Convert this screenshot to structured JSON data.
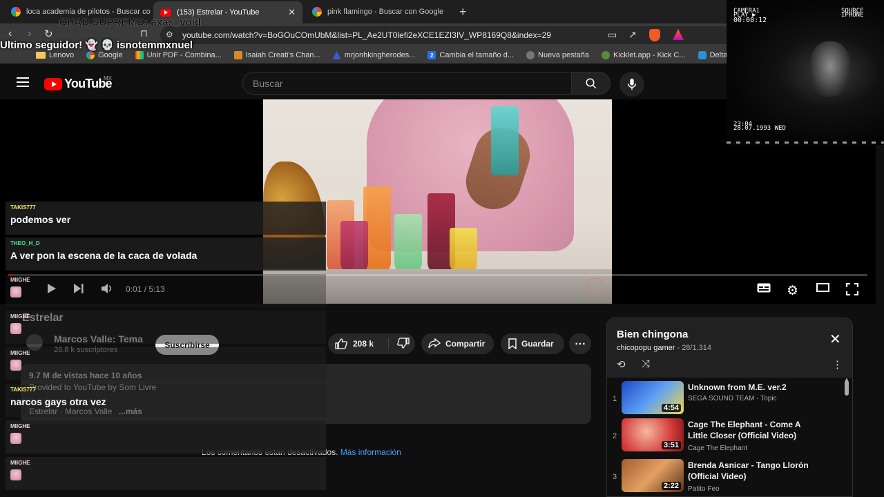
{
  "browser": {
    "tabs": [
      {
        "title": "loca academia de pilotos - Buscar con",
        "icon": "google-icon",
        "active": false
      },
      {
        "title": "(153) Estrelar - YouTube",
        "icon": "youtube-icon",
        "active": true
      },
      {
        "title": "pink flamingo - Buscar con Google",
        "icon": "google-icon",
        "active": false
      }
    ],
    "url": "youtube.com/watch?v=BoGOuCOmUbM&list=PL_Ae2UT0lefi2eXCE1EZI3IV_WP8169Q8&index=29",
    "bookmarks": [
      {
        "label": "Lenovo",
        "icon": "folder-icon"
      },
      {
        "label": "Google",
        "icon": "google-icon"
      },
      {
        "label": "Unir PDF - Combina...",
        "icon": "pdf-icon"
      },
      {
        "label": "Isaiah Creati's Chan...",
        "icon": "image-icon"
      },
      {
        "label": "mrjonhkingherodes...",
        "icon": "drive-icon"
      },
      {
        "label": "Cambia el tamaño d...",
        "icon": "resize-icon"
      },
      {
        "label": "Nueva pestaña",
        "icon": "globe-icon"
      },
      {
        "label": "Kicklet.app - Kick C...",
        "icon": "kicklet-icon"
      },
      {
        "label": "Deltarune: C",
        "icon": "deltarune-icon"
      }
    ]
  },
  "youtube": {
    "logo": "YouTube",
    "region": "MX",
    "search_placeholder": "Buscar"
  },
  "player": {
    "time": "0:01 / 5:13",
    "progress": 0.003
  },
  "video": {
    "title": "Estrelar",
    "channel": "Marcos Valle: Tema",
    "subscribers": "26.8 k suscriptores",
    "subscribe_label": "Suscribirse",
    "likes": "208 k",
    "share_label": "Compartir",
    "save_label": "Guardar",
    "views_age": "9.7 M de vistas  hace 10 años",
    "description_line1": "Provided to YouTube by Som Livre",
    "description_line2": "Estrelar · Marcos Valle",
    "more_label": "...más",
    "comments_off": "Los comentarios están desactivados.",
    "more_info": "Más información"
  },
  "playlist": {
    "title": "Bien chingona",
    "owner": "chicopopu gamer",
    "position": "28/1,314",
    "items": [
      {
        "index": "1",
        "title": "Unknown from M.E. ver.2",
        "channel": "SEGA SOUND TEAM - Topic",
        "duration": "4:54"
      },
      {
        "index": "2",
        "title": "Cage The Elephant - Come A Little Closer (Official Video)",
        "channel": "Cage The Elephant",
        "duration": "3:51"
      },
      {
        "index": "3",
        "title": "Brenda Asnicar - Tango Llorón (Official Video)",
        "channel": "Patito Feo",
        "duration": "2:22"
      }
    ]
  },
  "overlay": {
    "top_text": "CHAD SUPREMO: axas_void",
    "follower_text": "Ultimo seguidor! 👻 💀 isnotemmxnuel",
    "camera": {
      "line1": "CAMERA1",
      "line2": "PLAY ▶",
      "line3": "00:08:12",
      "source1": "SOURCE",
      "source2": "IPHONE",
      "clock": "23:04",
      "date": "28.07.1993 WED"
    },
    "chat": [
      {
        "user": "TAKIS777",
        "text": "podemos ver",
        "color": "#f4e46b"
      },
      {
        "user": "THEO_H_D",
        "text": "A ver pon la escena de la caca de volada",
        "color": "#55e39f"
      },
      {
        "user": "MIIGHE",
        "text": "",
        "color": "#f0d7e4"
      },
      {
        "user": "MIIGHE",
        "text": "",
        "color": "#f0d7e4"
      },
      {
        "user": "MIIGHE",
        "text": "",
        "color": "#f0d7e4"
      },
      {
        "user": "TAKIS777",
        "text": "narcos gays otra vez",
        "color": "#f4e46b"
      },
      {
        "user": "MIIGHE",
        "text": "",
        "color": "#f0d7e4"
      },
      {
        "user": "MIIGHE",
        "text": "",
        "color": "#f0d7e4"
      }
    ]
  }
}
